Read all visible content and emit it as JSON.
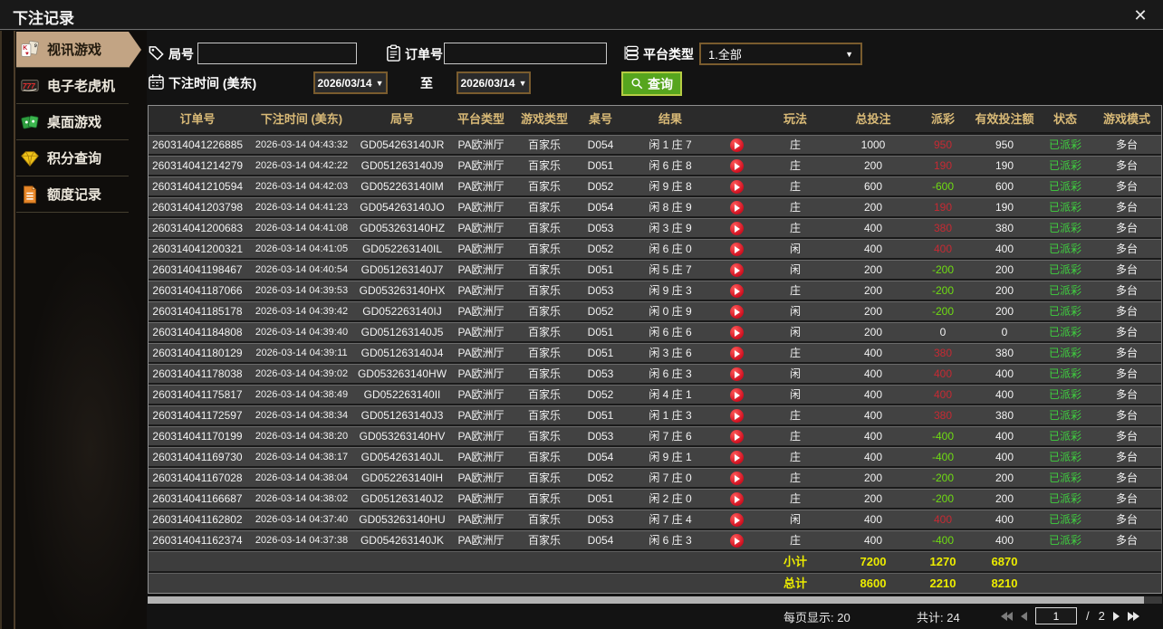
{
  "window": {
    "title": "下注记录"
  },
  "icons": {
    "close": "✕",
    "dropdown_arrow": "▼"
  },
  "colors": {
    "sidebar_active_tan": "#c2a484",
    "header_gold": "#d9ba77",
    "positive_red": "#c62a33",
    "negative_green": "#6fdc13",
    "status_green": "#3fd13f",
    "totals_yellow": "#ecec00",
    "search_button_green": "#56a51e",
    "date_border_brown": "#7a5c2e"
  },
  "sidebar": {
    "items": [
      {
        "label": "视讯游戏",
        "icon": "playing-cards-icon",
        "active": true
      },
      {
        "label": "电子老虎机",
        "icon": "slot-machine-icon",
        "active": false
      },
      {
        "label": "桌面游戏",
        "icon": "table-games-icon",
        "active": false
      },
      {
        "label": "积分查询",
        "icon": "diamond-icon",
        "active": false
      },
      {
        "label": "额度记录",
        "icon": "document-icon",
        "active": false
      }
    ]
  },
  "filters": {
    "round_label": "局号",
    "round_value": "",
    "order_label": "订单号",
    "order_value": "",
    "platform_label": "平台类型",
    "platform_value": "1.全部",
    "time_label": "下注时间 (美东)",
    "to_label": "至",
    "date_from": "2026/03/14",
    "date_to": "2026/03/14",
    "search_label": "查询"
  },
  "table": {
    "headers": [
      "订单号",
      "下注时间 (美东)",
      "局号",
      "平台类型",
      "游戏类型",
      "桌号",
      "结果",
      "",
      "玩法",
      "总投注",
      "派彩",
      "有效投注额",
      "状态",
      "游戏模式"
    ],
    "rows": [
      {
        "order_id": "260314041226885",
        "bet_time": "2026-03-14 04:43:32",
        "round_id": "GD054263140JR",
        "platform": "PA欧洲厅",
        "game_type": "百家乐",
        "table_id": "D054",
        "result": "闲 1 庄 7",
        "play": "庄",
        "total_bet": "1000",
        "payout": "950",
        "valid_bet": "950",
        "status": "已派彩",
        "mode": "多台"
      },
      {
        "order_id": "260314041214279",
        "bet_time": "2026-03-14 04:42:22",
        "round_id": "GD051263140J9",
        "platform": "PA欧洲厅",
        "game_type": "百家乐",
        "table_id": "D051",
        "result": "闲 6 庄 8",
        "play": "庄",
        "total_bet": "200",
        "payout": "190",
        "valid_bet": "190",
        "status": "已派彩",
        "mode": "多台"
      },
      {
        "order_id": "260314041210594",
        "bet_time": "2026-03-14 04:42:03",
        "round_id": "GD052263140IM",
        "platform": "PA欧洲厅",
        "game_type": "百家乐",
        "table_id": "D052",
        "result": "闲 9 庄 8",
        "play": "庄",
        "total_bet": "600",
        "payout": "-600",
        "valid_bet": "600",
        "status": "已派彩",
        "mode": "多台"
      },
      {
        "order_id": "260314041203798",
        "bet_time": "2026-03-14 04:41:23",
        "round_id": "GD054263140JO",
        "platform": "PA欧洲厅",
        "game_type": "百家乐",
        "table_id": "D054",
        "result": "闲 8 庄 9",
        "play": "庄",
        "total_bet": "200",
        "payout": "190",
        "valid_bet": "190",
        "status": "已派彩",
        "mode": "多台"
      },
      {
        "order_id": "260314041200683",
        "bet_time": "2026-03-14 04:41:08",
        "round_id": "GD053263140HZ",
        "platform": "PA欧洲厅",
        "game_type": "百家乐",
        "table_id": "D053",
        "result": "闲 3 庄 9",
        "play": "庄",
        "total_bet": "400",
        "payout": "380",
        "valid_bet": "380",
        "status": "已派彩",
        "mode": "多台"
      },
      {
        "order_id": "260314041200321",
        "bet_time": "2026-03-14 04:41:05",
        "round_id": "GD052263140IL",
        "platform": "PA欧洲厅",
        "game_type": "百家乐",
        "table_id": "D052",
        "result": "闲 6 庄 0",
        "play": "闲",
        "total_bet": "400",
        "payout": "400",
        "valid_bet": "400",
        "status": "已派彩",
        "mode": "多台"
      },
      {
        "order_id": "260314041198467",
        "bet_time": "2026-03-14 04:40:54",
        "round_id": "GD051263140J7",
        "platform": "PA欧洲厅",
        "game_type": "百家乐",
        "table_id": "D051",
        "result": "闲 5 庄 7",
        "play": "闲",
        "total_bet": "200",
        "payout": "-200",
        "valid_bet": "200",
        "status": "已派彩",
        "mode": "多台"
      },
      {
        "order_id": "260314041187066",
        "bet_time": "2026-03-14 04:39:53",
        "round_id": "GD053263140HX",
        "platform": "PA欧洲厅",
        "game_type": "百家乐",
        "table_id": "D053",
        "result": "闲 9 庄 3",
        "play": "庄",
        "total_bet": "200",
        "payout": "-200",
        "valid_bet": "200",
        "status": "已派彩",
        "mode": "多台"
      },
      {
        "order_id": "260314041185178",
        "bet_time": "2026-03-14 04:39:42",
        "round_id": "GD052263140IJ",
        "platform": "PA欧洲厅",
        "game_type": "百家乐",
        "table_id": "D052",
        "result": "闲 0 庄 9",
        "play": "闲",
        "total_bet": "200",
        "payout": "-200",
        "valid_bet": "200",
        "status": "已派彩",
        "mode": "多台"
      },
      {
        "order_id": "260314041184808",
        "bet_time": "2026-03-14 04:39:40",
        "round_id": "GD051263140J5",
        "platform": "PA欧洲厅",
        "game_type": "百家乐",
        "table_id": "D051",
        "result": "闲 6 庄 6",
        "play": "闲",
        "total_bet": "200",
        "payout": "0",
        "valid_bet": "0",
        "status": "已派彩",
        "mode": "多台"
      },
      {
        "order_id": "260314041180129",
        "bet_time": "2026-03-14 04:39:11",
        "round_id": "GD051263140J4",
        "platform": "PA欧洲厅",
        "game_type": "百家乐",
        "table_id": "D051",
        "result": "闲 3 庄 6",
        "play": "庄",
        "total_bet": "400",
        "payout": "380",
        "valid_bet": "380",
        "status": "已派彩",
        "mode": "多台"
      },
      {
        "order_id": "260314041178038",
        "bet_time": "2026-03-14 04:39:02",
        "round_id": "GD053263140HW",
        "platform": "PA欧洲厅",
        "game_type": "百家乐",
        "table_id": "D053",
        "result": "闲 6 庄 3",
        "play": "闲",
        "total_bet": "400",
        "payout": "400",
        "valid_bet": "400",
        "status": "已派彩",
        "mode": "多台"
      },
      {
        "order_id": "260314041175817",
        "bet_time": "2026-03-14 04:38:49",
        "round_id": "GD052263140II",
        "platform": "PA欧洲厅",
        "game_type": "百家乐",
        "table_id": "D052",
        "result": "闲 4 庄 1",
        "play": "闲",
        "total_bet": "400",
        "payout": "400",
        "valid_bet": "400",
        "status": "已派彩",
        "mode": "多台"
      },
      {
        "order_id": "260314041172597",
        "bet_time": "2026-03-14 04:38:34",
        "round_id": "GD051263140J3",
        "platform": "PA欧洲厅",
        "game_type": "百家乐",
        "table_id": "D051",
        "result": "闲 1 庄 3",
        "play": "庄",
        "total_bet": "400",
        "payout": "380",
        "valid_bet": "380",
        "status": "已派彩",
        "mode": "多台"
      },
      {
        "order_id": "260314041170199",
        "bet_time": "2026-03-14 04:38:20",
        "round_id": "GD053263140HV",
        "platform": "PA欧洲厅",
        "game_type": "百家乐",
        "table_id": "D053",
        "result": "闲 7 庄 6",
        "play": "庄",
        "total_bet": "400",
        "payout": "-400",
        "valid_bet": "400",
        "status": "已派彩",
        "mode": "多台"
      },
      {
        "order_id": "260314041169730",
        "bet_time": "2026-03-14 04:38:17",
        "round_id": "GD054263140JL",
        "platform": "PA欧洲厅",
        "game_type": "百家乐",
        "table_id": "D054",
        "result": "闲 9 庄 1",
        "play": "庄",
        "total_bet": "400",
        "payout": "-400",
        "valid_bet": "400",
        "status": "已派彩",
        "mode": "多台"
      },
      {
        "order_id": "260314041167028",
        "bet_time": "2026-03-14 04:38:04",
        "round_id": "GD052263140IH",
        "platform": "PA欧洲厅",
        "game_type": "百家乐",
        "table_id": "D052",
        "result": "闲 7 庄 0",
        "play": "庄",
        "total_bet": "200",
        "payout": "-200",
        "valid_bet": "200",
        "status": "已派彩",
        "mode": "多台"
      },
      {
        "order_id": "260314041166687",
        "bet_time": "2026-03-14 04:38:02",
        "round_id": "GD051263140J2",
        "platform": "PA欧洲厅",
        "game_type": "百家乐",
        "table_id": "D051",
        "result": "闲 2 庄 0",
        "play": "庄",
        "total_bet": "200",
        "payout": "-200",
        "valid_bet": "200",
        "status": "已派彩",
        "mode": "多台"
      },
      {
        "order_id": "260314041162802",
        "bet_time": "2026-03-14 04:37:40",
        "round_id": "GD053263140HU",
        "platform": "PA欧洲厅",
        "game_type": "百家乐",
        "table_id": "D053",
        "result": "闲 7 庄 4",
        "play": "闲",
        "total_bet": "400",
        "payout": "400",
        "valid_bet": "400",
        "status": "已派彩",
        "mode": "多台"
      },
      {
        "order_id": "260314041162374",
        "bet_time": "2026-03-14 04:37:38",
        "round_id": "GD054263140JK",
        "platform": "PA欧洲厅",
        "game_type": "百家乐",
        "table_id": "D054",
        "result": "闲 6 庄 3",
        "play": "庄",
        "total_bet": "400",
        "payout": "-400",
        "valid_bet": "400",
        "status": "已派彩",
        "mode": "多台"
      }
    ],
    "subtotal": {
      "label": "小计",
      "total_bet": "7200",
      "payout": "1270",
      "valid_bet": "6870"
    },
    "total": {
      "label": "总计",
      "total_bet": "8600",
      "payout": "2210",
      "valid_bet": "8210"
    }
  },
  "pagination": {
    "page_size_label": "每页显示:",
    "page_size_value": "20",
    "total_count_label": "共计:",
    "total_count_value": "24",
    "current_page": "1",
    "separator": "/",
    "total_pages": "2"
  }
}
